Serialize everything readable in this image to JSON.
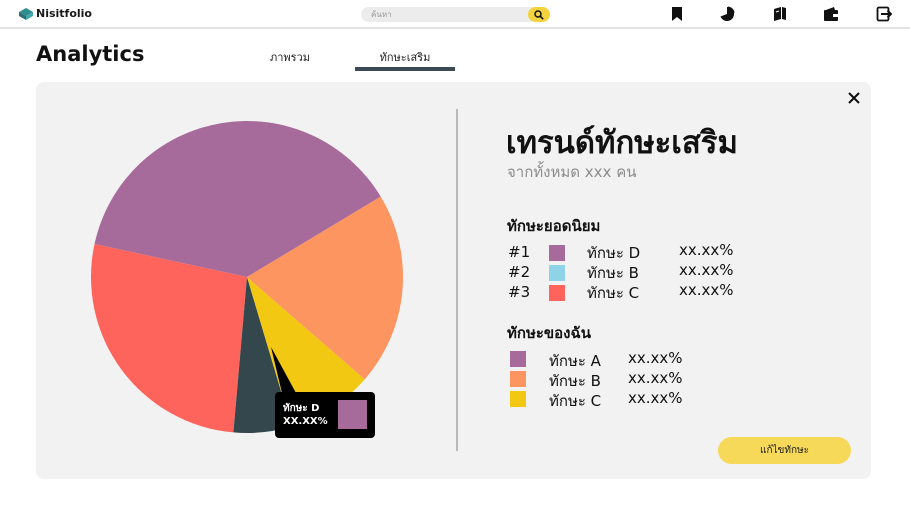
{
  "app": {
    "name": "Nisitfolio"
  },
  "search": {
    "placeholder": "ค้นหา"
  },
  "nav": {
    "icons": [
      "bookmark-icon",
      "pie-chart-icon",
      "book-icon",
      "wallet-icon",
      "logout-icon"
    ]
  },
  "page": {
    "title": "Analytics"
  },
  "tabs": [
    {
      "label": "ภาพรวม",
      "active": false
    },
    {
      "label": "ทักษะเสริม",
      "active": true
    }
  ],
  "tooltip": {
    "label": "ทักษะ D",
    "value": "XX.XX%",
    "color": "#a66b9b"
  },
  "panel": {
    "title": "เทรนด์ทักษะเสริม",
    "subtitle": "จากทั้งหมด xxx คน",
    "popular": {
      "title": "ทักษะยอดนิยม",
      "items": [
        {
          "rank": "#1",
          "name": "ทักษะ D",
          "value": "xx.xx%",
          "color": "#a66b9b"
        },
        {
          "rank": "#2",
          "name": "ทักษะ B",
          "value": "xx.xx%",
          "color": "#8fd3e8"
        },
        {
          "rank": "#3",
          "name": "ทักษะ C",
          "value": "xx.xx%",
          "color": "#fe645c"
        }
      ]
    },
    "mine": {
      "title": "ทักษะของฉัน",
      "items": [
        {
          "name": "ทักษะ A",
          "value": "xx.xx%",
          "color": "#a66b9b"
        },
        {
          "name": "ทักษะ B",
          "value": "xx.xx%",
          "color": "#fc955f"
        },
        {
          "name": "ทักษะ C",
          "value": "xx.xx%",
          "color": "#f2c813"
        }
      ]
    },
    "edit_label": "แก้ไขทักษะ"
  },
  "chart_data": {
    "type": "pie",
    "slices": [
      {
        "color": "#a66b9b",
        "value": 38
      },
      {
        "color": "#fe645c",
        "value": 27
      },
      {
        "color": "#34474c",
        "value": 6
      },
      {
        "color": "#f2c813",
        "value": 9
      },
      {
        "color": "#fc955f",
        "value": 20
      }
    ]
  }
}
